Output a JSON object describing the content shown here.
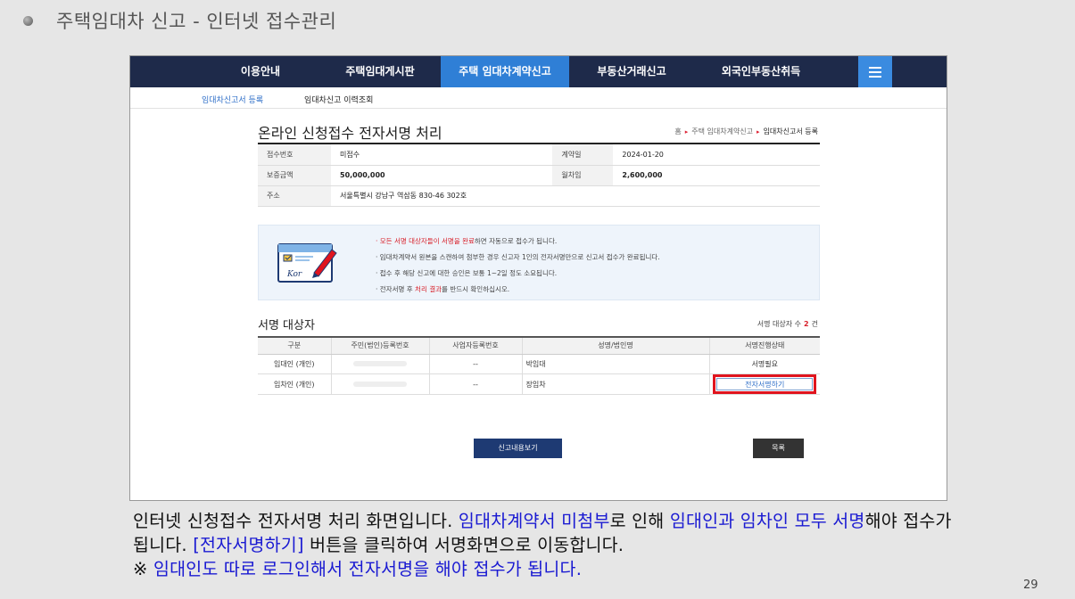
{
  "slide": {
    "title": "주택임대차 신고 - 인터넷 접수관리",
    "page_number": "29"
  },
  "gnb": {
    "items": [
      "이용안내",
      "주택임대게시판",
      "주택 임대차계약신고",
      "부동산거래신고",
      "외국인부동산취득"
    ],
    "active_index": 2
  },
  "lnb": {
    "items": [
      "임대차신고서 등록",
      "임대차신고 이력조회"
    ]
  },
  "page": {
    "title": "온라인 신청접수 전자서명 처리",
    "breadcrumb": [
      "홈",
      "주택 임대차계약신고",
      "임대차신고서 등록"
    ]
  },
  "info": {
    "receipt_no_label": "접수번호",
    "receipt_no": "미접수",
    "contract_date_label": "계약일",
    "contract_date": "2024-01-20",
    "deposit_label": "보증금액",
    "deposit": "50,000,000",
    "rent_label": "월차임",
    "rent": "2,600,000",
    "address_label": "주소",
    "address": "서울특별시 강남구 역삼동 830-46 302호"
  },
  "notice": {
    "img_label": "Kor",
    "l1_red": "· 모든 서명 대상자들이 서명을 완료",
    "l1_rest": "하면 자동으로 접수가 됩니다.",
    "l2": "· 임대차계약서 원본을 스캔하여 첨부한 경우 신고자 1인의 전자서명만으로 신고서 접수가 완료됩니다.",
    "l3": "· 접수 후 해당 신고에 대한 승인은 보통 1~2일 정도 소요됩니다.",
    "l4_a": "· 전자서명 후 ",
    "l4_red": "처리 결과",
    "l4_b": "를 반드시 확인하십시오."
  },
  "signers": {
    "title": "서명 대상자",
    "count_label": "서명 대상자 수",
    "count": "2",
    "count_unit": "건",
    "columns": [
      "구분",
      "주민(법인)등록번호",
      "사업자등록번호",
      "성명/법인명",
      "서명진행상태"
    ],
    "rows": [
      {
        "type": "임대인 (개인)",
        "biz_no": "--",
        "name": "박임대",
        "status": "서명필요"
      },
      {
        "type": "임차인 (개인)",
        "biz_no": "--",
        "name": "장임차",
        "action": "전자서명하기"
      }
    ]
  },
  "buttons": {
    "view": "신고내용보기",
    "list": "목록"
  },
  "caption": {
    "p1": "인터넷 신청접수 전자서명 처리 화면입니다. ",
    "b1": "임대차계약서 미첨부",
    "p2": "로 인해 ",
    "b2": "임대인과 임차인 모두 서명",
    "p3": "해야 접수가 됩니다. ",
    "b3": "[전자서명하기]",
    "p4": " 버튼을 클릭하여 서명화면으로 이동합니다.",
    "p5": "※ ",
    "b4": "임대인도 따로 로그인해서 전자서명을 해야 접수가 됩니다."
  },
  "colors": {
    "gnb_bg": "#1e2a4a",
    "gnb_active": "#2f7fd6",
    "highlight": "#e0141e",
    "caption_blue": "#1a1ad2"
  }
}
